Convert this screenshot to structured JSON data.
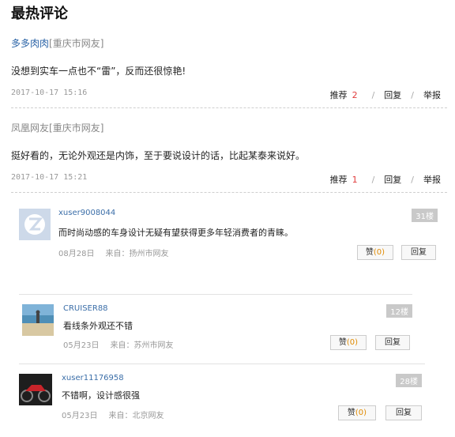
{
  "section_title": "最热评论",
  "hot_comments": [
    {
      "user": "多多肉肉",
      "location": "[重庆市网友]",
      "content": "没想到实车一点也不“雷”，反而还很惊艳!",
      "time": "2017-10-17 15:16",
      "recommend_label": "推荐",
      "recommend_count": "2",
      "reply_label": "回复",
      "report_label": "举报"
    },
    {
      "user": "凤凰网友",
      "location": "[重庆市网友]",
      "content": "挺好看的，无论外观还是内饰，至于要说设计的话，比起某泰来说好。",
      "time": "2017-10-17 15:21",
      "recommend_label": "推荐",
      "recommend_count": "1",
      "reply_label": "回复",
      "report_label": "举报"
    }
  ],
  "sub_comments": [
    {
      "username": "xuser9008044",
      "floor": "31楼",
      "text": "而时尚动感的车身设计无疑有望获得更多年轻消费者的青睐。",
      "date": "08月28日",
      "from": "来自：扬州市网友",
      "like_label": "赞",
      "like_count": "(0)",
      "reply_label": "回复"
    },
    {
      "username": "CRUISER88",
      "floor": "12楼",
      "text": "看线条外观还不错",
      "date": "05月23日",
      "from": "来自：苏州市网友",
      "like_label": "赞",
      "like_count": "(0)",
      "reply_label": "回复"
    },
    {
      "username": "xuser11176958",
      "floor": "28楼",
      "text": "不错啊，设计感很强",
      "date": "05月23日",
      "from": "来自：北京网友",
      "like_label": "赞",
      "like_count": "(0)",
      "reply_label": "回复"
    }
  ]
}
